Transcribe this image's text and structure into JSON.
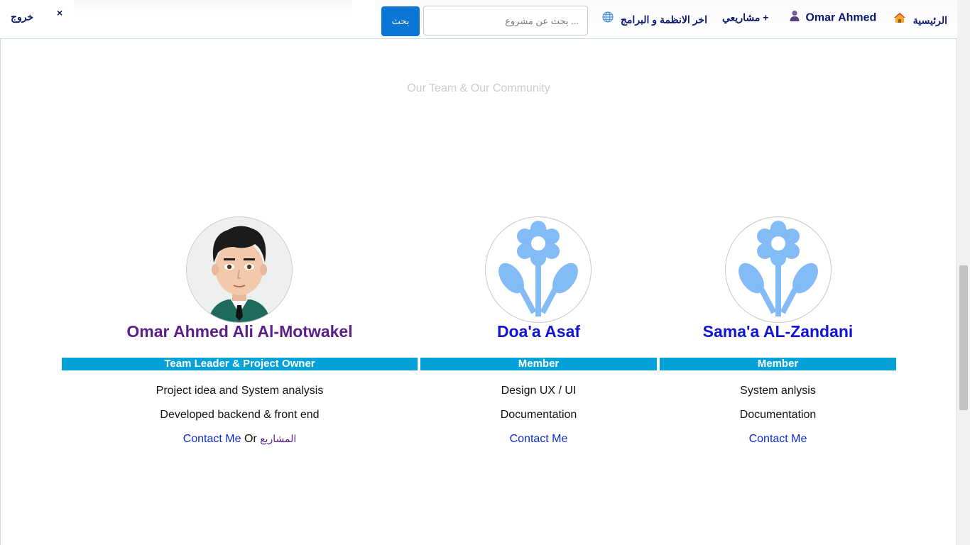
{
  "nav": {
    "home_label": "الرئيسية",
    "user_label": "Omar Ahmed",
    "projects_label": "مشاريعي +",
    "systems_label": "اخر الانظمة و البرامج",
    "search_button": "بحث",
    "search_placeholder": "... بحث عن مشروع",
    "logout_label": "خروج",
    "close_label": "×",
    "icons": [
      "home-icon",
      "user-icon",
      "globe-icon",
      "close-icon"
    ]
  },
  "section": {
    "title": "Our Team & Our Community"
  },
  "members": [
    {
      "name": "Omar Ahmed Ali Al-Motwakel",
      "name_color": "#5b1f8a",
      "role": "Team Leader & Project Owner",
      "tasks": [
        "Project idea and System analysis",
        "Developed backend & front end"
      ],
      "contact": "Contact Me",
      "or_text": "Or",
      "projects_link": "المشاريع",
      "avatar": "cartoon-man-avatar"
    },
    {
      "name": "Doa'a Asaf",
      "name_color": "#1014d8",
      "role": "Member",
      "tasks": [
        "Design UX / UI",
        "Documentation"
      ],
      "contact": "Contact Me",
      "avatar": "flower-icon"
    },
    {
      "name": "Sama'a AL-Zandani",
      "name_color": "#1014d8",
      "role": "Member",
      "tasks": [
        "System anlysis",
        "Documentation"
      ],
      "contact": "Contact Me",
      "avatar": "flower-icon"
    }
  ],
  "colors": {
    "accent": "#04a2d9",
    "button": "#0b76d6",
    "nav_text": "#0a1a6e",
    "link": "#0b2bd8",
    "flower": "#82bbf5"
  }
}
